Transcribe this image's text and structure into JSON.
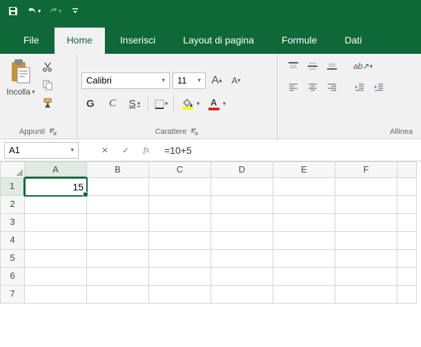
{
  "qat": {
    "undo_disabled": false,
    "redo_disabled": true
  },
  "tabs": {
    "file": "File",
    "home": "Home",
    "insert": "Inserisci",
    "layout": "Layout di pagina",
    "formulas": "Formule",
    "data": "Dati",
    "active": "home"
  },
  "ribbon": {
    "clipboard": {
      "paste": "Incolla",
      "group_label": "Appunti"
    },
    "font": {
      "name": "Calibri",
      "size": "11",
      "bold": "G",
      "italic": "C",
      "underline": "S",
      "group_label": "Carattere",
      "fill_color": "#ffff00",
      "text_color": "#e02020"
    },
    "alignment": {
      "group_label": "Allinea"
    }
  },
  "formula_bar": {
    "namebox": "A1",
    "formula": "=10+5",
    "fx_label": "fx"
  },
  "columns": [
    "A",
    "B",
    "C",
    "D",
    "E",
    "F"
  ],
  "rows": [
    "1",
    "2",
    "3",
    "4",
    "5",
    "6",
    "7"
  ],
  "selected_cell": "A1",
  "chart_data": {
    "type": "table",
    "cells": {
      "A1": 15
    }
  }
}
